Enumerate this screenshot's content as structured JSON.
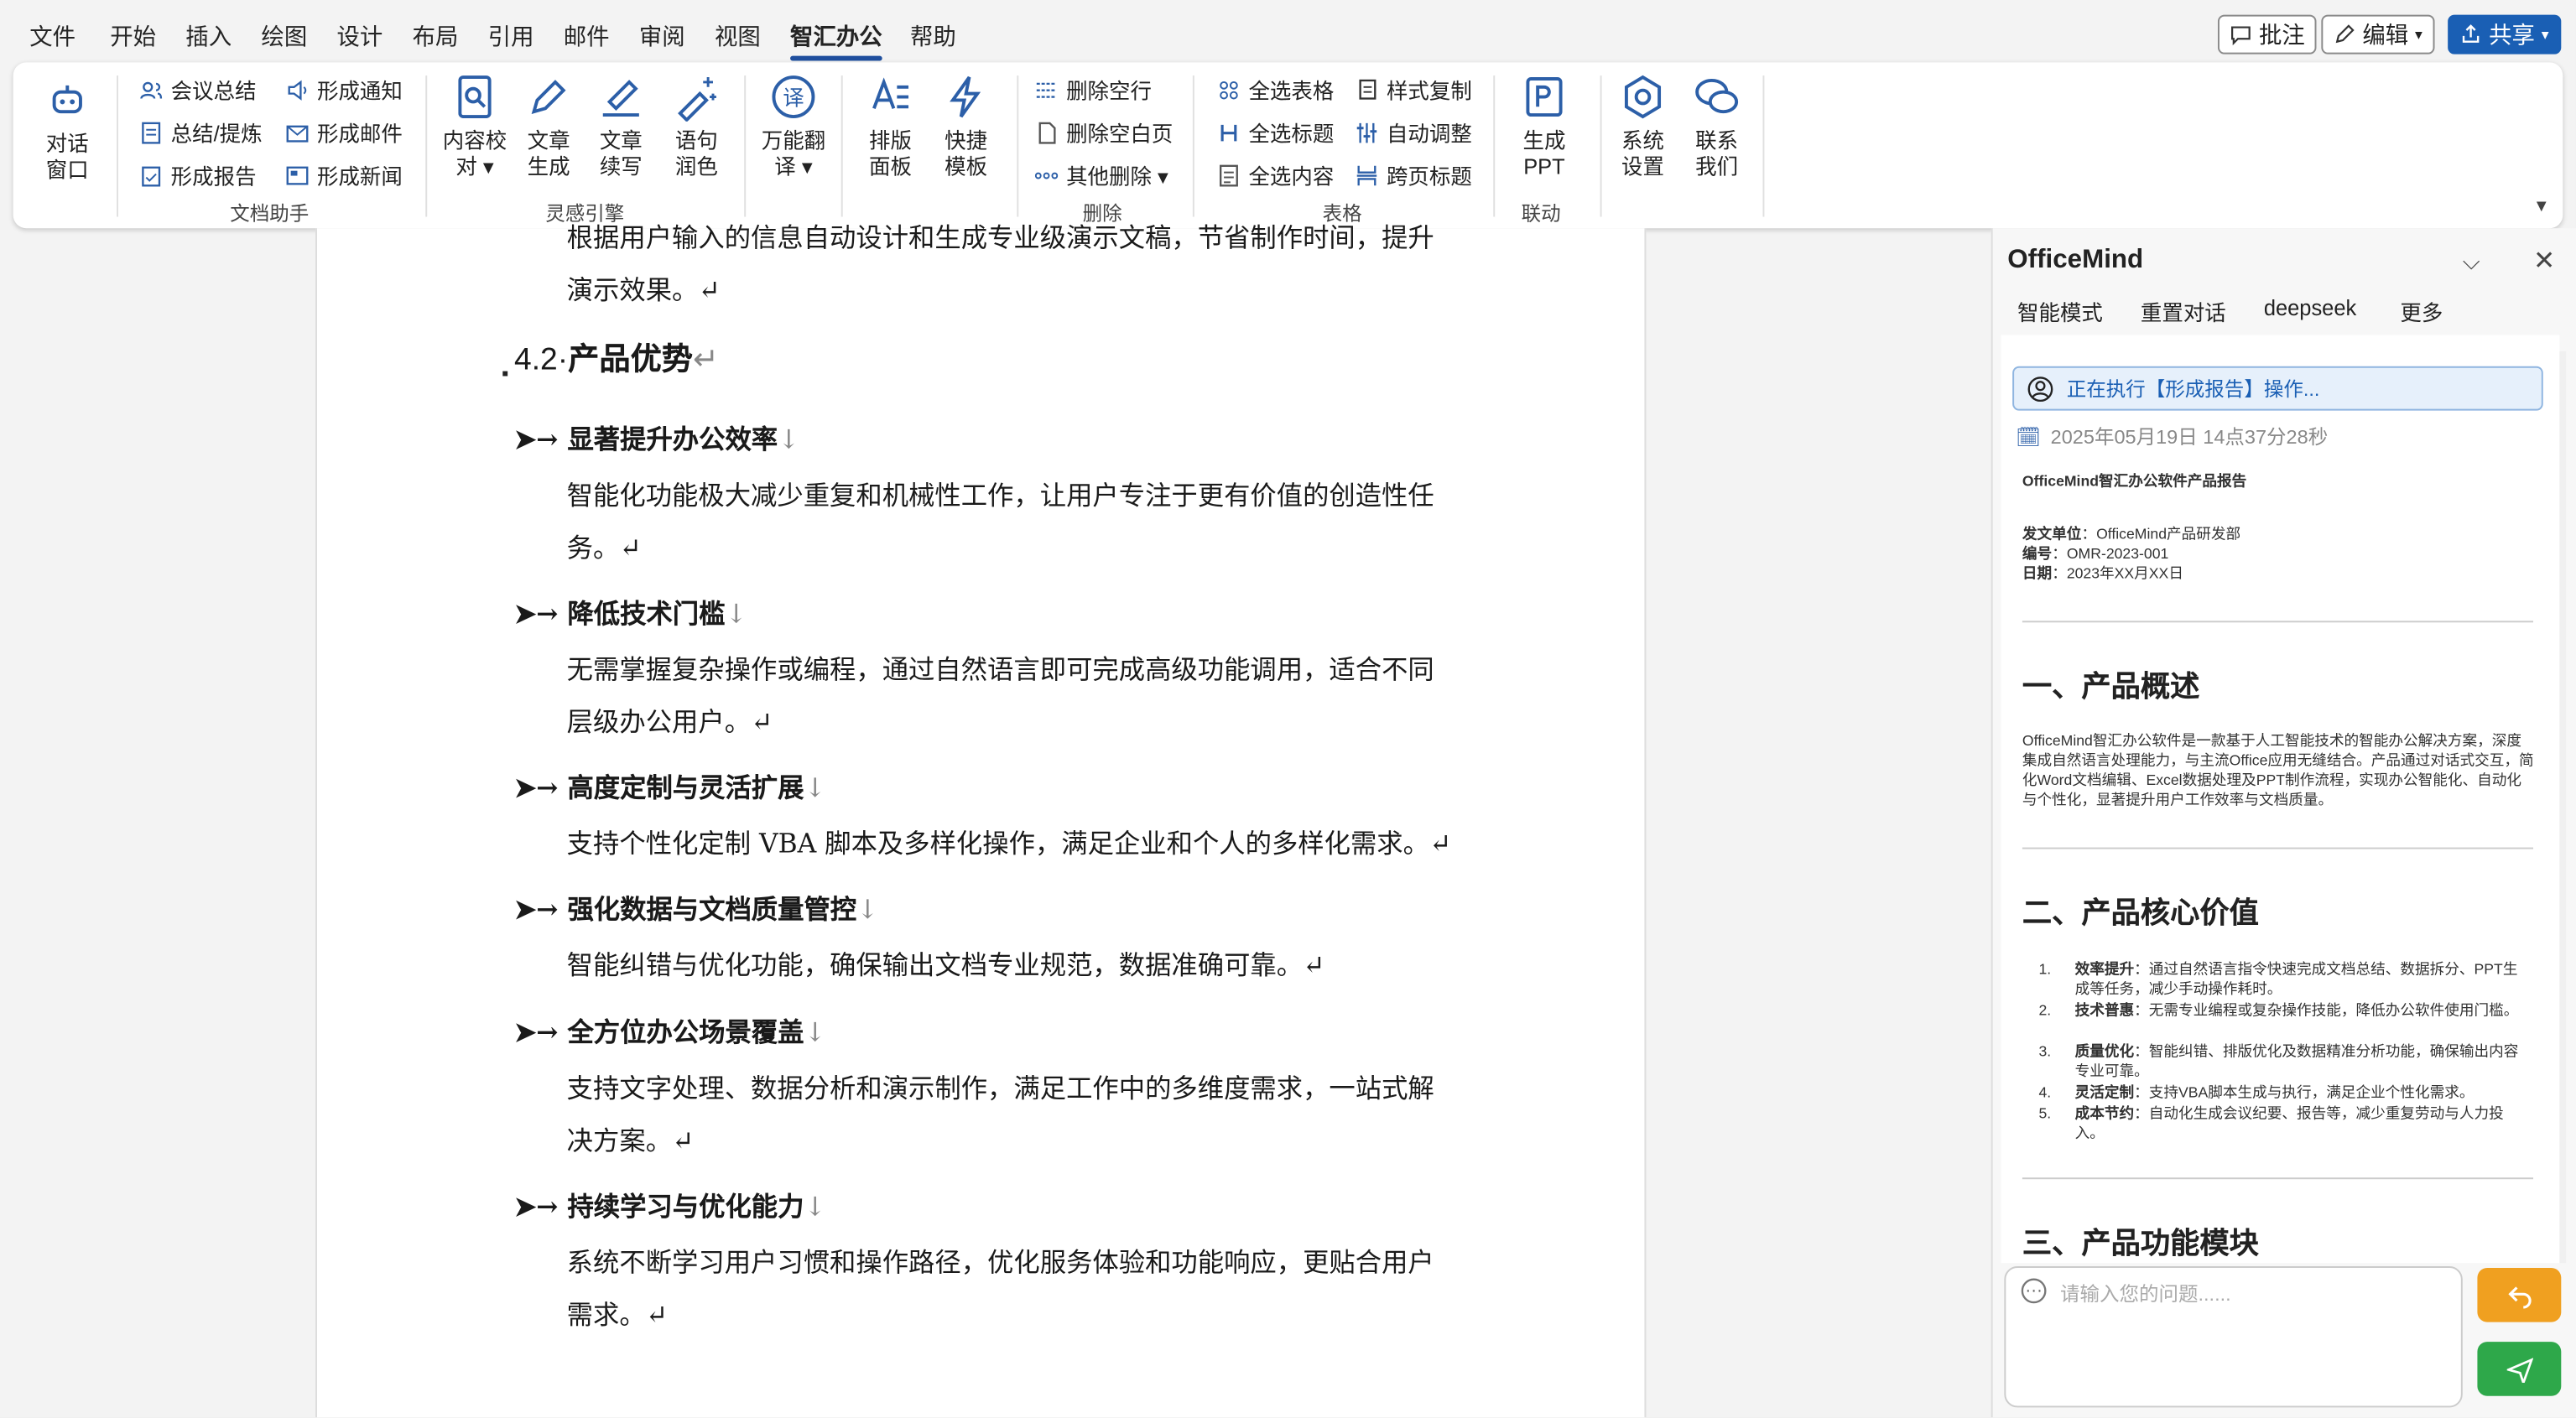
{
  "menu": [
    "文件",
    "开始",
    "插入",
    "绘图",
    "设计",
    "布局",
    "引用",
    "邮件",
    "审阅",
    "视图",
    "智汇办公",
    "帮助"
  ],
  "top_buttons": {
    "comment": "批注",
    "edit": "编辑",
    "share": "共享"
  },
  "ribbon": {
    "dialog_window": "对话窗口",
    "doc_assistant": {
      "items": [
        "会议总结",
        "总结/提炼",
        "形成报告",
        "形成通知",
        "形成邮件",
        "形成新闻"
      ],
      "label": "文档助手"
    },
    "inspiration": {
      "items": [
        "内容校对",
        "文章生成",
        "文章续写",
        "语句润色",
        "万能翻译"
      ],
      "label": "灵感引擎"
    },
    "layout": [
      "排版面板",
      "快捷模板"
    ],
    "delete": {
      "items": [
        "删除空行",
        "删除空白页",
        "其他删除"
      ],
      "label": "删除"
    },
    "table": {
      "items": [
        "全选表格",
        "全选标题",
        "全选内容",
        "样式复制",
        "自动调整",
        "跨页标题"
      ],
      "label": "表格"
    },
    "link": {
      "items": [
        "生成PPT"
      ],
      "label": "联动"
    },
    "settings": [
      "系统设置",
      "联系我们"
    ]
  },
  "doc": {
    "intro": [
      "根据用户输入的信息自动设计和生成专业级演示文稿，节省制作时间，提升",
      "演示效果。↵"
    ],
    "section_num": "4.2",
    "section_title": "产品优势",
    "items": [
      {
        "h": "显著提升办公效率",
        "lines": [
          "智能化功能极大减少重复和机械性工作，让用户专注于更有价值的创造性任",
          "务。↵"
        ]
      },
      {
        "h": "降低技术门槛",
        "lines": [
          "无需掌握复杂操作或编程，通过自然语言即可完成高级功能调用，适合不同",
          "层级办公用户。↵"
        ]
      },
      {
        "h": "高度定制与灵活扩展",
        "lines": [
          "支持个性化定制 VBA 脚本及多样化操作，满足企业和个人的多样化需求。↵"
        ]
      },
      {
        "h": "强化数据与文档质量管控",
        "lines": [
          "智能纠错与优化功能，确保输出文档专业规范，数据准确可靠。↵"
        ]
      },
      {
        "h": "全方位办公场景覆盖",
        "lines": [
          "支持文字处理、数据分析和演示制作，满足工作中的多维度需求，一站式解",
          "决方案。↵"
        ]
      },
      {
        "h": "持续学习与优化能力",
        "lines": [
          "系统不断学习用户习惯和操作路径，优化服务体验和功能响应，更贴合用户",
          "需求。↵"
        ]
      }
    ]
  },
  "panel": {
    "title": "OfficeMind",
    "tabs": [
      "智能模式",
      "重置对话",
      "deepseek",
      "更多"
    ],
    "status": "正在执行【形成报告】操作...",
    "timestamp": "2025年05月19日 14点37分28秒",
    "report": {
      "title": "OfficeMind智汇办公软件产品报告",
      "meta": [
        {
          "k": "发文单位",
          "v": "：OfficeMind产品研发部"
        },
        {
          "k": "编号",
          "v": "：OMR-2023-001"
        },
        {
          "k": "日期",
          "v": "：2023年XX月XX日"
        }
      ],
      "h1": "一、产品概述",
      "overview": "OfficeMind智汇办公软件是一款基于人工智能技术的智能办公解决方案，深度集成自然语言处理能力，与主流Office应用无缝结合。产品通过对话式交互，简化Word文档编辑、Excel数据处理及PPT制作流程，实现办公智能化、自动化与个性化，显著提升用户工作效率与文档质量。",
      "h2": "二、产品核心价值",
      "values": [
        {
          "n": "1.",
          "k": "效率提升",
          "v": "：通过自然语言指令快速完成文档总结、数据拆分、PPT生成等任务，减少手动操作耗时。"
        },
        {
          "n": "2.",
          "k": "技术普惠",
          "v": "：无需专业编程或复杂操作技能，降低办公软件使用门槛。"
        },
        {
          "n": "3.",
          "k": "质量优化",
          "v": "：智能纠错、排版优化及数据精准分析功能，确保输出内容专业可靠。"
        },
        {
          "n": "4.",
          "k": "灵活定制",
          "v": "：支持VBA脚本生成与执行，满足企业个性化需求。"
        },
        {
          "n": "5.",
          "k": "成本节约",
          "v": "：自动化生成会议纪要、报告等，减少重复劳动与人力投入。"
        }
      ],
      "h3": "三、产品功能模块"
    },
    "input_placeholder": "请输入您的问题......"
  },
  "colors": {
    "accent": "#1a5fb4",
    "send": "#2ea84a",
    "undo": "#f0a020"
  }
}
